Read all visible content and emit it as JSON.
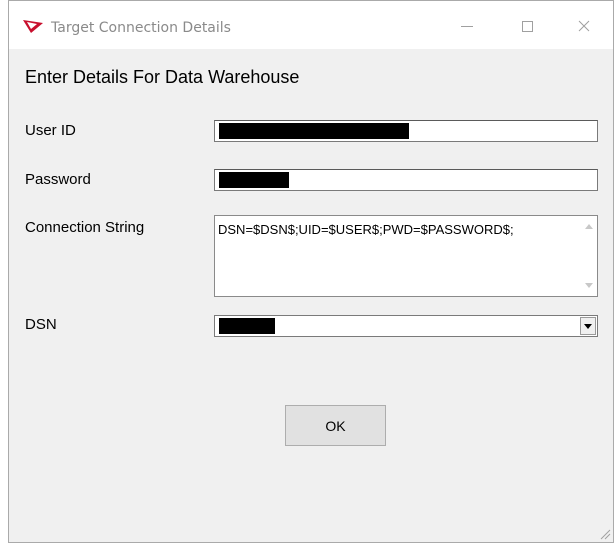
{
  "window": {
    "title": "Target Connection Details",
    "icon": "app-logo-icon",
    "controls": [
      "minimize-icon",
      "maximize-icon",
      "close-icon"
    ]
  },
  "form": {
    "heading": "Enter Details For Data Warehouse",
    "user_id": {
      "label": "User ID",
      "value": ""
    },
    "password": {
      "label": "Password",
      "value": ""
    },
    "connection_string": {
      "label": "Connection String",
      "value": "DSN=$DSN$;UID=$USER$;PWD=$PASSWORD$;"
    },
    "dsn": {
      "label": "DSN",
      "value": ""
    }
  },
  "buttons": {
    "ok_label": "OK"
  },
  "colors": {
    "window_bg": "#f0f0f0",
    "titlebar_bg": "#ffffff",
    "title_text": "#8a8a8a",
    "redaction": "#000000",
    "button_bg": "#e1e1e1",
    "app_icon_red": "#c8102e"
  }
}
